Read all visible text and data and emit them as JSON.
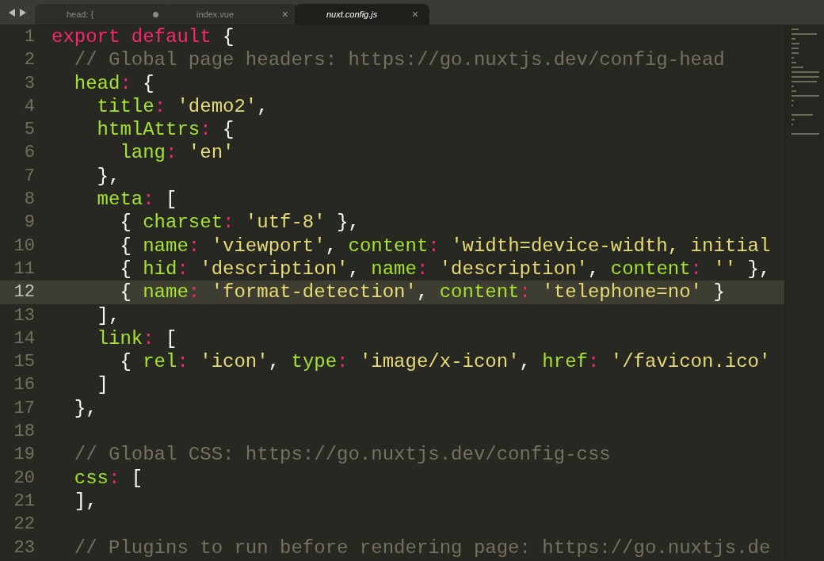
{
  "tabs": [
    {
      "label": "head: {",
      "selected": false,
      "dirty": true
    },
    {
      "label": "index.vue",
      "selected": false,
      "dirty": false,
      "close": "×"
    },
    {
      "label": "nuxt.config.js",
      "selected": true,
      "dirty": false,
      "close": "×"
    }
  ],
  "editor": {
    "lines": [
      {
        "number": "1",
        "current": false,
        "tokens": [
          {
            "kind": "keyword",
            "text": "export default"
          },
          {
            "kind": "plain",
            "text": " {"
          }
        ]
      },
      {
        "number": "2",
        "current": false,
        "tokens": [
          {
            "kind": "comment",
            "text": "  // Global page headers: https://go.nuxtjs.dev/config-head"
          }
        ]
      },
      {
        "number": "3",
        "current": false,
        "tokens": [
          {
            "kind": "property",
            "text": "  head"
          },
          {
            "kind": "keyword",
            "text": ": "
          },
          {
            "kind": "plain",
            "text": "{"
          }
        ]
      },
      {
        "number": "4",
        "current": false,
        "tokens": [
          {
            "kind": "property",
            "text": "    title"
          },
          {
            "kind": "keyword",
            "text": ": "
          },
          {
            "kind": "string",
            "text": "'demo2'"
          },
          {
            "kind": "plain",
            "text": ","
          }
        ]
      },
      {
        "number": "5",
        "current": false,
        "tokens": [
          {
            "kind": "property",
            "text": "    htmlAttrs"
          },
          {
            "kind": "keyword",
            "text": ": "
          },
          {
            "kind": "plain",
            "text": "{"
          }
        ]
      },
      {
        "number": "6",
        "current": false,
        "tokens": [
          {
            "kind": "property",
            "text": "      lang"
          },
          {
            "kind": "keyword",
            "text": ": "
          },
          {
            "kind": "string",
            "text": "'en'"
          }
        ]
      },
      {
        "number": "7",
        "current": false,
        "tokens": [
          {
            "kind": "plain",
            "text": "    },"
          }
        ]
      },
      {
        "number": "8",
        "current": false,
        "tokens": [
          {
            "kind": "property",
            "text": "    meta"
          },
          {
            "kind": "keyword",
            "text": ": "
          },
          {
            "kind": "plain",
            "text": "["
          }
        ]
      },
      {
        "number": "9",
        "current": false,
        "tokens": [
          {
            "kind": "plain",
            "text": "      { "
          },
          {
            "kind": "property",
            "text": "charset"
          },
          {
            "kind": "keyword",
            "text": ": "
          },
          {
            "kind": "string",
            "text": "'utf-8'"
          },
          {
            "kind": "plain",
            "text": " },"
          }
        ]
      },
      {
        "number": "10",
        "current": false,
        "tokens": [
          {
            "kind": "plain",
            "text": "      { "
          },
          {
            "kind": "property",
            "text": "name"
          },
          {
            "kind": "keyword",
            "text": ": "
          },
          {
            "kind": "string",
            "text": "'viewport'"
          },
          {
            "kind": "plain",
            "text": ", "
          },
          {
            "kind": "property",
            "text": "content"
          },
          {
            "kind": "keyword",
            "text": ": "
          },
          {
            "kind": "string",
            "text": "'width=device-width, initial"
          }
        ]
      },
      {
        "number": "11",
        "current": false,
        "tokens": [
          {
            "kind": "plain",
            "text": "      { "
          },
          {
            "kind": "property",
            "text": "hid"
          },
          {
            "kind": "keyword",
            "text": ": "
          },
          {
            "kind": "string",
            "text": "'description'"
          },
          {
            "kind": "plain",
            "text": ", "
          },
          {
            "kind": "property",
            "text": "name"
          },
          {
            "kind": "keyword",
            "text": ": "
          },
          {
            "kind": "string",
            "text": "'description'"
          },
          {
            "kind": "plain",
            "text": ", "
          },
          {
            "kind": "property",
            "text": "content"
          },
          {
            "kind": "keyword",
            "text": ": "
          },
          {
            "kind": "string",
            "text": "''"
          },
          {
            "kind": "plain",
            "text": " },"
          }
        ]
      },
      {
        "number": "12",
        "current": true,
        "tokens": [
          {
            "kind": "plain",
            "text": "      { "
          },
          {
            "kind": "property",
            "text": "name"
          },
          {
            "kind": "keyword",
            "text": ": "
          },
          {
            "kind": "string",
            "text": "'format-detection'"
          },
          {
            "kind": "plain",
            "text": ", "
          },
          {
            "kind": "property",
            "text": "content"
          },
          {
            "kind": "keyword",
            "text": ": "
          },
          {
            "kind": "string",
            "text": "'telephone=no'"
          },
          {
            "kind": "plain",
            "text": " }"
          }
        ]
      },
      {
        "number": "13",
        "current": false,
        "tokens": [
          {
            "kind": "plain",
            "text": "    ],"
          }
        ]
      },
      {
        "number": "14",
        "current": false,
        "tokens": [
          {
            "kind": "property",
            "text": "    link"
          },
          {
            "kind": "keyword",
            "text": ": "
          },
          {
            "kind": "plain",
            "text": "["
          }
        ]
      },
      {
        "number": "15",
        "current": false,
        "tokens": [
          {
            "kind": "plain",
            "text": "      { "
          },
          {
            "kind": "property",
            "text": "rel"
          },
          {
            "kind": "keyword",
            "text": ": "
          },
          {
            "kind": "string",
            "text": "'icon'"
          },
          {
            "kind": "plain",
            "text": ", "
          },
          {
            "kind": "property",
            "text": "type"
          },
          {
            "kind": "keyword",
            "text": ": "
          },
          {
            "kind": "string",
            "text": "'image/x-icon'"
          },
          {
            "kind": "plain",
            "text": ", "
          },
          {
            "kind": "property",
            "text": "href"
          },
          {
            "kind": "keyword",
            "text": ": "
          },
          {
            "kind": "string",
            "text": "'/favicon.ico'"
          }
        ]
      },
      {
        "number": "16",
        "current": false,
        "tokens": [
          {
            "kind": "plain",
            "text": "    ]"
          }
        ]
      },
      {
        "number": "17",
        "current": false,
        "tokens": [
          {
            "kind": "plain",
            "text": "  },"
          }
        ]
      },
      {
        "number": "18",
        "current": false
      },
      {
        "number": "19",
        "current": false,
        "tokens": [
          {
            "kind": "comment",
            "text": "  // Global CSS: https://go.nuxtjs.dev/config-css"
          }
        ]
      },
      {
        "number": "20",
        "current": false,
        "tokens": [
          {
            "kind": "property",
            "text": "  css"
          },
          {
            "kind": "keyword",
            "text": ": "
          },
          {
            "kind": "plain",
            "text": "["
          }
        ]
      },
      {
        "number": "21",
        "current": false,
        "tokens": [
          {
            "kind": "plain",
            "text": "  ],"
          }
        ]
      },
      {
        "number": "22",
        "current": false
      },
      {
        "number": "23",
        "current": false,
        "tokens": [
          {
            "kind": "comment",
            "text": "  // Plugins to run before rendering page: https://go.nuxtjs.de"
          }
        ]
      }
    ]
  }
}
